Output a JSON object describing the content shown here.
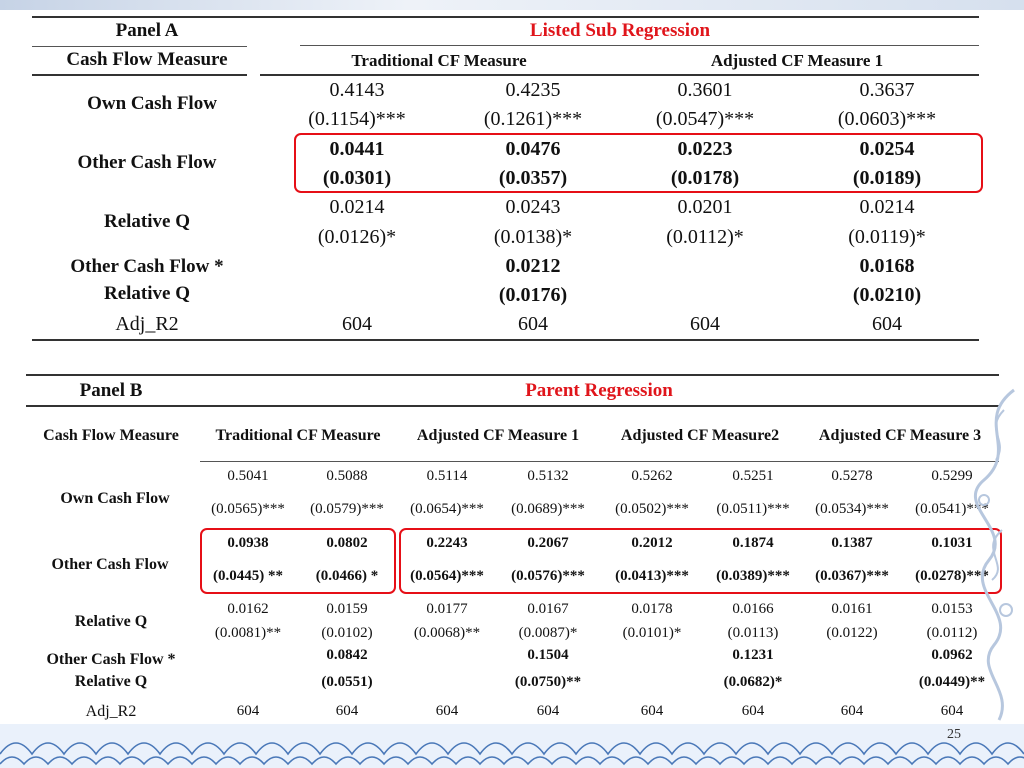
{
  "panel_a": {
    "label": "Panel A",
    "title": "Listed Sub Regression",
    "row_header": "Cash Flow Measure",
    "col_groups": [
      "Traditional CF Measure",
      "Adjusted CF Measure 1"
    ],
    "rows": [
      {
        "label": "Own Cash Flow",
        "bold": false,
        "coef": [
          "0.4143",
          "0.4235",
          "0.3601",
          "0.3637"
        ],
        "se": [
          "(0.1154)***",
          "(0.1261)***",
          "(0.0547)***",
          "(0.0603)***"
        ]
      },
      {
        "label": "Other Cash Flow",
        "bold": true,
        "coef": [
          "0.0441",
          "0.0476",
          "0.0223",
          "0.0254"
        ],
        "se": [
          "(0.0301)",
          "(0.0357)",
          "(0.0178)",
          "(0.0189)"
        ]
      },
      {
        "label": "Relative Q",
        "bold": false,
        "coef": [
          "0.0214",
          "0.0243",
          "0.0201",
          "0.0214"
        ],
        "se": [
          "(0.0126)*",
          "(0.0138)*",
          "(0.0112)*",
          "(0.0119)*"
        ]
      },
      {
        "label_line1": "Other Cash Flow *",
        "label_line2": "Relative Q",
        "bold": true,
        "coef": [
          "",
          "0.0212",
          "",
          "0.0168"
        ],
        "se": [
          "",
          "(0.0176)",
          "",
          "(0.0210)"
        ]
      }
    ],
    "adj_r2": {
      "label": "Adj_R2",
      "values": [
        "604",
        "604",
        "604",
        "604"
      ]
    }
  },
  "panel_b": {
    "label": "Panel B",
    "title": "Parent Regression",
    "row_header": "Cash Flow Measure",
    "col_groups": [
      "Traditional CF Measure",
      "Adjusted CF Measure 1",
      "Adjusted CF Measure2",
      "Adjusted CF Measure 3"
    ],
    "rows": [
      {
        "label": "Own Cash Flow",
        "bold": false,
        "coef": [
          "0.5041",
          "0.5088",
          "0.5114",
          "0.5132",
          "0.5262",
          "0.5251",
          "0.5278",
          "0.5299"
        ],
        "se": [
          "(0.0565)***",
          "(0.0579)***",
          "(0.0654)***",
          "(0.0689)***",
          "(0.0502)***",
          "(0.0511)***",
          "(0.0534)***",
          "(0.0541)***"
        ]
      },
      {
        "label": "Other Cash Flow",
        "bold": true,
        "coef": [
          "0.0938",
          "0.0802",
          "0.2243",
          "0.2067",
          "0.2012",
          "0.1874",
          "0.1387",
          "0.1031"
        ],
        "se": [
          "(0.0445) **",
          "(0.0466) *",
          "(0.0564)***",
          "(0.0576)***",
          "(0.0413)***",
          "(0.0389)***",
          "(0.0367)***",
          "(0.0278)***"
        ]
      },
      {
        "label": "Relative Q",
        "bold": false,
        "coef": [
          "0.0162",
          "0.0159",
          "0.0177",
          "0.0167",
          "0.0178",
          "0.0166",
          "0.0161",
          "0.0153"
        ],
        "se": [
          "(0.0081)**",
          "(0.0102)",
          "(0.0068)**",
          "(0.0087)*",
          "(0.0101)*",
          "(0.0113)",
          "(0.0122)",
          "(0.0112)"
        ]
      },
      {
        "label_line1": "Other Cash Flow *",
        "label_line2": "Relative Q",
        "bold": true,
        "coef": [
          "",
          "0.0842",
          "",
          "0.1504",
          "",
          "0.1231",
          "",
          "0.0962"
        ],
        "se": [
          "",
          "(0.0551)",
          "",
          "(0.0750)**",
          "",
          "(0.0682)*",
          "",
          "(0.0449)**"
        ]
      }
    ],
    "adj_r2": {
      "label": "Adj_R2",
      "values": [
        "604",
        "604",
        "604",
        "604",
        "604",
        "604",
        "604",
        "604"
      ]
    }
  },
  "page_number": "25",
  "colors": {
    "highlight_box": "#e60f17",
    "title_red": "#e0151b",
    "wave_blue": "#4a78b8"
  }
}
